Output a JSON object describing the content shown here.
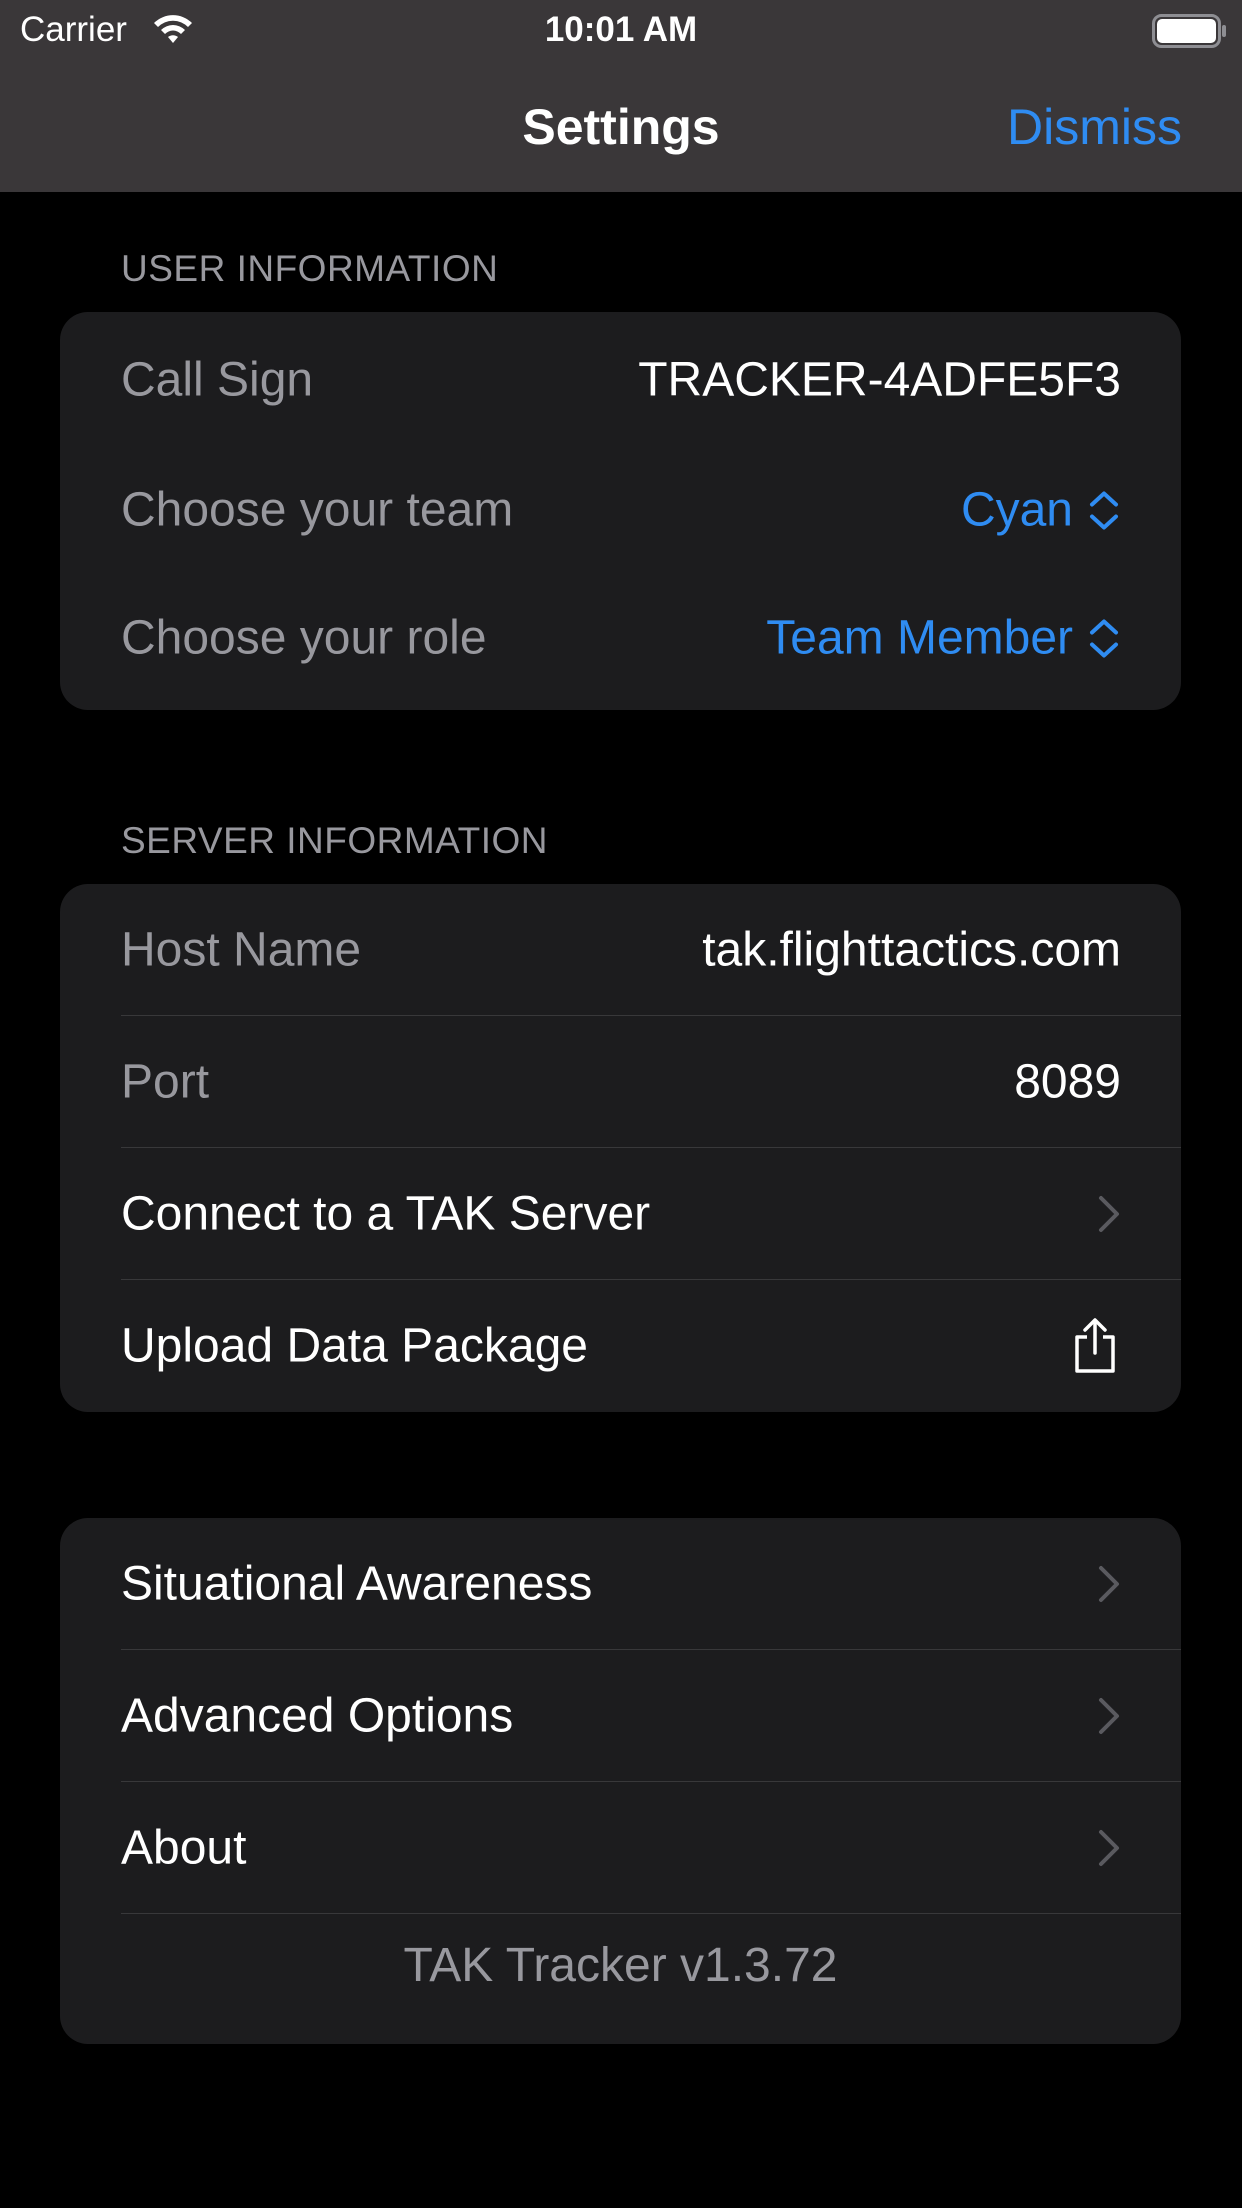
{
  "status_bar": {
    "carrier": "Carrier",
    "time": "10:01 AM"
  },
  "nav": {
    "title": "Settings",
    "dismiss": "Dismiss"
  },
  "user_info": {
    "header": "USER INFORMATION",
    "call_sign_label": "Call Sign",
    "call_sign_value": "TRACKER-4ADFE5F3",
    "team_label": "Choose your team",
    "team_value": "Cyan",
    "role_label": "Choose your role",
    "role_value": "Team Member"
  },
  "server_info": {
    "header": "SERVER INFORMATION",
    "host_label": "Host Name",
    "host_value": "tak.flighttactics.com",
    "port_label": "Port",
    "port_value": "8089",
    "connect_label": "Connect to a TAK Server",
    "upload_label": "Upload Data Package"
  },
  "more": {
    "situational_awareness": "Situational Awareness",
    "advanced_options": "Advanced Options",
    "about": "About",
    "version": "TAK Tracker v1.3.72"
  },
  "colors": {
    "accent": "#2f8cf2",
    "header_bg": "#3a3739",
    "card_bg": "#1c1c1e",
    "secondary_text": "#98989e"
  },
  "icons": {
    "wifi": "wifi-icon",
    "battery": "battery-icon",
    "picker": "chevron-up-down-icon",
    "disclosure": "chevron-right-icon",
    "share": "share-icon"
  }
}
